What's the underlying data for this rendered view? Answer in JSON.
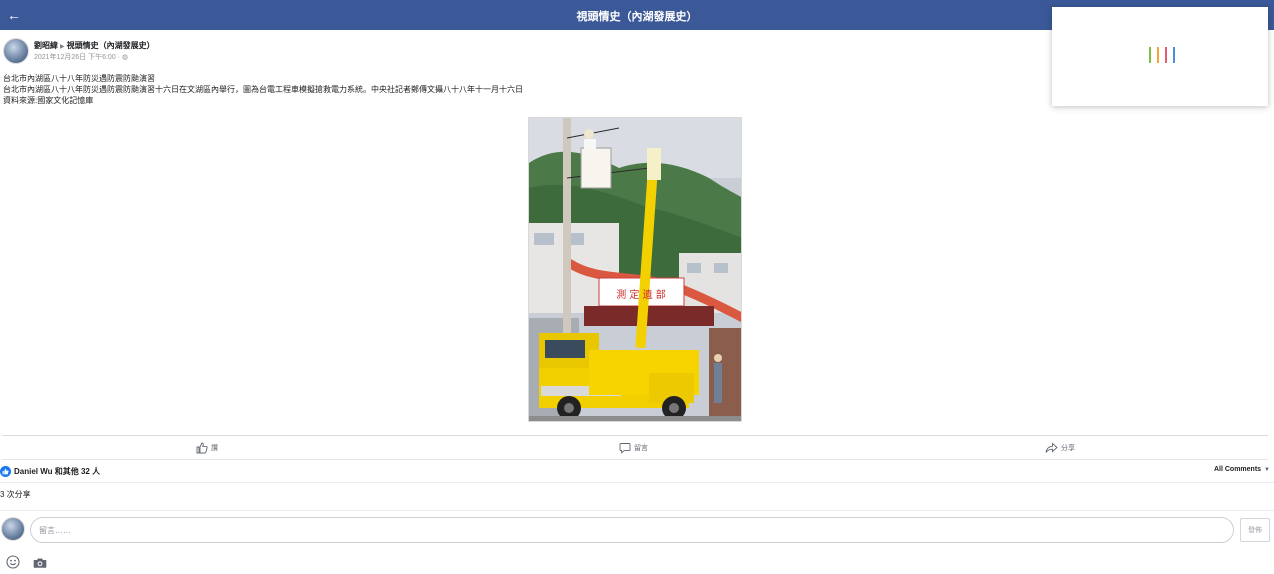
{
  "topbar": {
    "back_icon": "arrow-left-icon",
    "title": "視頭情史（內湖發展史）"
  },
  "post": {
    "author": "劉昭緯",
    "group": "視頭情史（內湖發展史）",
    "timestamp": "2021年12月26日 下午6:00 · ",
    "text_lines": [
      "台北市內湖區八十八年防災遇防震防颱演習",
      "台北市內湖區八十八年防災遇防震防颱演習十六日在文湖區內舉行，圖為台電工程車模擬搶救電力系統。中央社記者鄭傳文攝八十八年十一月十六日",
      "資料來源:國家文化記憶庫"
    ],
    "photo_sign": "測 定 遺 部"
  },
  "actions": {
    "like": "讚",
    "comment": "留言",
    "share": "分享"
  },
  "reactions": {
    "summary": "Daniel Wu 和其他 32 人",
    "all_comments": "All Comments"
  },
  "shares": "3 次分享",
  "comment_box": {
    "placeholder": "留言……",
    "post_button": "發佈"
  },
  "colors": {
    "topbar": "#3b5998",
    "like_blue": "#1877f2",
    "loader_bars": [
      "#7bc043",
      "#f7a532",
      "#e85a71",
      "#4a90d9"
    ]
  }
}
